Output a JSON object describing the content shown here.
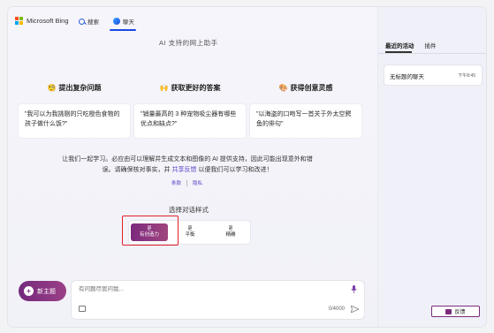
{
  "header": {
    "brand": "Microsoft Bing",
    "tabs": [
      {
        "label": "搜索",
        "icon": "search-icon"
      },
      {
        "label": "聊天",
        "icon": "chat-icon"
      }
    ],
    "brand_colors": [
      "#f25022",
      "#7fba00",
      "#00a4ef",
      "#ffb900"
    ]
  },
  "main": {
    "subtitle": "AI 支持的网上助手",
    "features": [
      {
        "emoji": "🧐",
        "title": "提出复杂问题",
        "example": "\"我可以为我挑剔的只吃橙色食物的孩子做什么饭?\""
      },
      {
        "emoji": "🙌",
        "title": "获取更好的答案",
        "example": "\"销量最高的 3 种宠物吸尘器有哪些优点和缺点?\""
      },
      {
        "emoji": "🎨",
        "title": "获得创意灵感",
        "example": "\"以海盗的口吻写一首关于外太空鳄鱼的俳句\""
      }
    ],
    "disclaimer_part1": "让我们一起学习。必应由可以理解并生成文本和图像的 AI 提供支持，因此可能出现意外和错误。请确保核对事实，并",
    "disclaimer_link": "共享反馈",
    "disclaimer_part2": "以便我们可以学习和改进！",
    "links": [
      "条款",
      "隐私"
    ],
    "style_title": "选择对话样式",
    "styles": [
      {
        "top": "更",
        "label": "有创造力",
        "selected": true
      },
      {
        "top": "更",
        "label": "平衡",
        "selected": false
      },
      {
        "top": "更",
        "label": "精确",
        "selected": false
      }
    ],
    "accent_color": "#8b3a82",
    "highlight_color": "#e0202a"
  },
  "composer": {
    "new_topic": "新主题",
    "placeholder": "有问题尽管问我...",
    "counter": "0/4000"
  },
  "panel": {
    "tabs": [
      "最近的活动",
      "插件"
    ],
    "history": [
      {
        "name": "无标题的聊天",
        "time": "下午8:45"
      }
    ]
  },
  "feedback": "反馈"
}
